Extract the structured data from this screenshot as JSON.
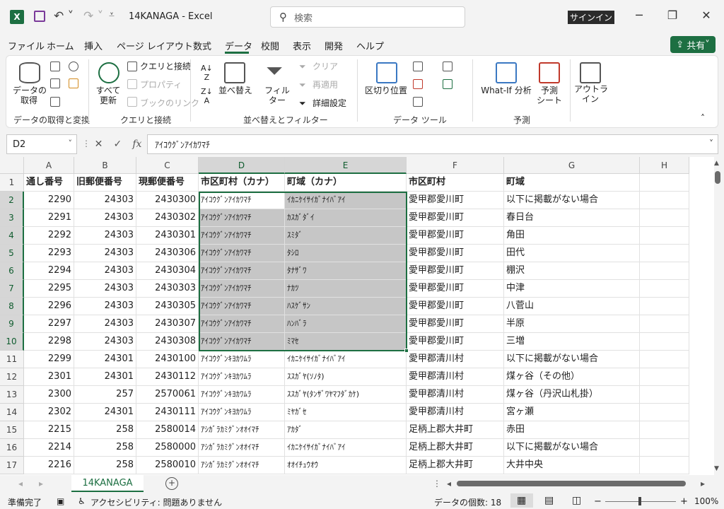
{
  "app": {
    "title": "14KANAGA  -  Excel",
    "logo": "X"
  },
  "search": {
    "placeholder": "検索"
  },
  "signin": "サインイン",
  "window": {
    "minimize": "─",
    "restore": "❐",
    "close": "✕"
  },
  "tabs": [
    "ファイル",
    "ホーム",
    "挿入",
    "ページ レイアウト",
    "数式",
    "データ",
    "校閲",
    "表示",
    "開発",
    "ヘルプ"
  ],
  "active_tab": "データ",
  "share": "共有",
  "ribbon": {
    "get_data": "データの\n取得",
    "refresh_all": "すべて\n更新",
    "queries_connections": "クエリと接続",
    "properties": "プロパティ",
    "edit_links": "ブックのリンク",
    "sort": "並べ替え",
    "filter": "フィルター",
    "clear": "クリア",
    "reapply": "再適用",
    "advanced": "詳細設定",
    "text_to_columns": "区切り位置",
    "what_if": "What-If 分析",
    "forecast_sheet": "予測\nシート",
    "outline": "アウトラ\nイン",
    "groups": {
      "get_transform": "データの取得と変換",
      "queries": "クエリと接続",
      "sort_filter": "並べ替えとフィルター",
      "data_tools": "データ ツール",
      "forecast": "予測"
    }
  },
  "formula_bar": {
    "name_box": "D2",
    "content": "ｱｲｺｳｸﾞﾝｱｲｶﾜﾏﾁ"
  },
  "columns": [
    "A",
    "B",
    "C",
    "D",
    "E",
    "F",
    "G",
    "H"
  ],
  "header_row": [
    "通し番号",
    "旧郵便番号",
    "現郵便番号",
    "市区町村（カナ）",
    "町域（カナ）",
    "市区町村",
    "町域",
    ""
  ],
  "rows": [
    [
      "2290",
      "24303",
      "2430300",
      "ｱｲｺｳｸﾞﾝｱｲｶﾜﾏﾁ",
      "ｲｶﾆｹｲｻｲｶﾞﾅｲﾊﾞｱｲ",
      "愛甲郡愛川町",
      "以下に掲載がない場合"
    ],
    [
      "2291",
      "24303",
      "2430302",
      "ｱｲｺｳｸﾞﾝｱｲｶﾜﾏﾁ",
      "ｶｽｶﾞﾀﾞｲ",
      "愛甲郡愛川町",
      "春日台"
    ],
    [
      "2292",
      "24303",
      "2430301",
      "ｱｲｺｳｸﾞﾝｱｲｶﾜﾏﾁ",
      "ｽﾐﾀﾞ",
      "愛甲郡愛川町",
      "角田"
    ],
    [
      "2293",
      "24303",
      "2430306",
      "ｱｲｺｳｸﾞﾝｱｲｶﾜﾏﾁ",
      "ﾀｼﾛ",
      "愛甲郡愛川町",
      "田代"
    ],
    [
      "2294",
      "24303",
      "2430304",
      "ｱｲｺｳｸﾞﾝｱｲｶﾜﾏﾁ",
      "ﾀﾅｻﾞﾜ",
      "愛甲郡愛川町",
      "棚沢"
    ],
    [
      "2295",
      "24303",
      "2430303",
      "ｱｲｺｳｸﾞﾝｱｲｶﾜﾏﾁ",
      "ﾅｶﾂ",
      "愛甲郡愛川町",
      "中津"
    ],
    [
      "2296",
      "24303",
      "2430305",
      "ｱｲｺｳｸﾞﾝｱｲｶﾜﾏﾁ",
      "ﾊｽｹﾞｻﾝ",
      "愛甲郡愛川町",
      "八菅山"
    ],
    [
      "2297",
      "24303",
      "2430307",
      "ｱｲｺｳｸﾞﾝｱｲｶﾜﾏﾁ",
      "ﾊﾝﾊﾞﾗ",
      "愛甲郡愛川町",
      "半原"
    ],
    [
      "2298",
      "24303",
      "2430308",
      "ｱｲｺｳｸﾞﾝｱｲｶﾜﾏﾁ",
      "ﾐﾏｾ",
      "愛甲郡愛川町",
      "三増"
    ],
    [
      "2299",
      "24301",
      "2430100",
      "ｱｲｺｳｸﾞﾝｷﾖｶﾜﾑﾗ",
      "ｲｶﾆｹｲｻｲｶﾞﾅｲﾊﾞｱｲ",
      "愛甲郡清川村",
      "以下に掲載がない場合"
    ],
    [
      "2301",
      "24301",
      "2430112",
      "ｱｲｺｳｸﾞﾝｷﾖｶﾜﾑﾗ",
      "ｽｽｶﾞﾔ(ｿﾉﾀ)",
      "愛甲郡清川村",
      "煤ヶ谷（その他）"
    ],
    [
      "2300",
      "257",
      "2570061",
      "ｱｲｺｳｸﾞﾝｷﾖｶﾜﾑﾗ",
      "ｽｽｶﾞﾔ(ﾀﾝｻﾞﾜﾔﾏﾌﾀﾞｶｹ)",
      "愛甲郡清川村",
      "煤ヶ谷（丹沢山札掛）"
    ],
    [
      "2302",
      "24301",
      "2430111",
      "ｱｲｺｳｸﾞﾝｷﾖｶﾜﾑﾗ",
      "ﾐﾔｶﾞｾ",
      "愛甲郡清川村",
      "宮ヶ瀬"
    ],
    [
      "2215",
      "258",
      "2580014",
      "ｱｼｶﾞﾗｶﾐｸﾞﾝｵｵｲﾏﾁ",
      "ｱｶﾀﾞ",
      "足柄上郡大井町",
      "赤田"
    ],
    [
      "2214",
      "258",
      "2580000",
      "ｱｼｶﾞﾗｶﾐｸﾞﾝｵｵｲﾏﾁ",
      "ｲｶﾆｹｲｻｲｶﾞﾅｲﾊﾞｱｲ",
      "足柄上郡大井町",
      "以下に掲載がない場合"
    ],
    [
      "2216",
      "258",
      "2580010",
      "ｱｼｶﾞﾗｶﾐｸﾞﾝｵｵｲﾏﾁ",
      "ｵｵｲﾁｭｳｵｳ",
      "足柄上郡大井町",
      "大井中央"
    ]
  ],
  "row_numbers": [
    "1",
    "2",
    "3",
    "4",
    "5",
    "6",
    "7",
    "8",
    "9",
    "10",
    "11",
    "12",
    "13",
    "14",
    "15",
    "16",
    "17"
  ],
  "sheet_tab": "14KANAGA",
  "status": {
    "ready": "準備完了",
    "accessibility": "アクセシビリティ: 問題ありません",
    "count": "データの個数: 18",
    "zoom": "100%"
  },
  "colors": {
    "accent": "#1d6f42"
  }
}
